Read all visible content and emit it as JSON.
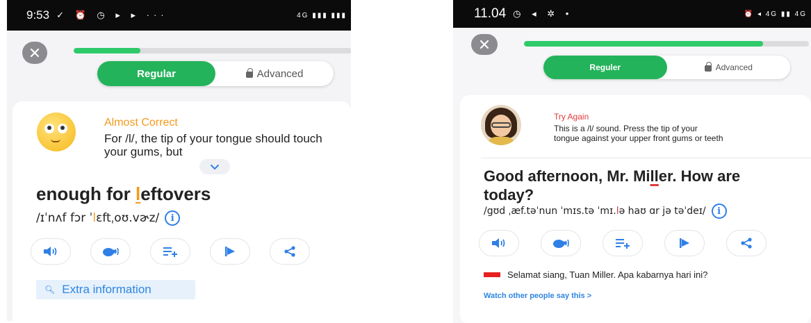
{
  "left": {
    "status": {
      "time": "9:53",
      "icons": "✓ ⏰ ◷ ▸ ▸ ···",
      "right": "4G ▮▮▮ ▮▮▮"
    },
    "progress": 0.24,
    "toggle": {
      "regular": "Regular",
      "advanced": "Advanced"
    },
    "feedback": {
      "title": "Almost Correct",
      "body": "For /l/, the tip of your tongue should touch your gums, but"
    },
    "phrase": {
      "before": "enough for ",
      "highlight": "l",
      "after": "eftovers"
    },
    "ipa": {
      "before": "/ɪˈnʌf fɔr ˈ",
      "highlight": "l",
      "after": "ɛftˌoʊ.vɚz/"
    },
    "info_icon": "i",
    "extra_info": "Extra information"
  },
  "right": {
    "status": {
      "time": "11.04",
      "icons": "◷ ◂ ✲ •",
      "right": "⏰ ◂ 4G ▮▮ 4G"
    },
    "progress": 0.84,
    "toggle": {
      "regular": "Reguler",
      "advanced": "Advanced"
    },
    "feedback": {
      "title": "Try Again",
      "line1": "This is a /l/ sound. Press the tip of your",
      "line2": "tongue against your upper front gums or teeth"
    },
    "phrase": {
      "line1_before": "Good afternoon, Mr. Mi",
      "line1_highlight": "ll",
      "line1_after": "er. How are",
      "line2": "today?"
    },
    "ipa": {
      "before": "/gʊd ˌæf.təˈnun ˈmɪs.tə ˈmɪ.",
      "highlight": "l",
      "after": "ə haʊ ɑr jə təˈdeɪ/"
    },
    "info_icon": "i",
    "translation": "Selamat siang, Tuan Miller. Apa kabarnya hari ini?",
    "watch_link": "Watch other people say this  >"
  },
  "colors": {
    "accent_green": "#23b35a",
    "orange": "#f39a1e",
    "red": "#e23b3b",
    "blue": "#2f86e0"
  }
}
